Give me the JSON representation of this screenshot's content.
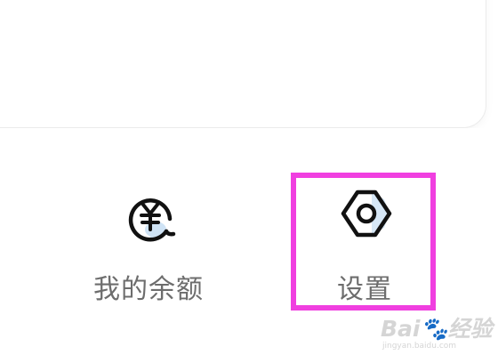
{
  "menu": {
    "items": [
      {
        "label": "我的余额",
        "icon": "yuan-coin-icon"
      },
      {
        "label": "设置",
        "icon": "gear-icon"
      }
    ]
  },
  "highlight": {
    "color": "#f03fe0",
    "target": "设置"
  },
  "watermark": {
    "logo": "Bai🐾经验",
    "url": "jingyan.baidu.com"
  },
  "colors": {
    "icon_stroke": "#111111",
    "icon_accent": "#cfe3f5",
    "label": "#6d6d6d"
  }
}
